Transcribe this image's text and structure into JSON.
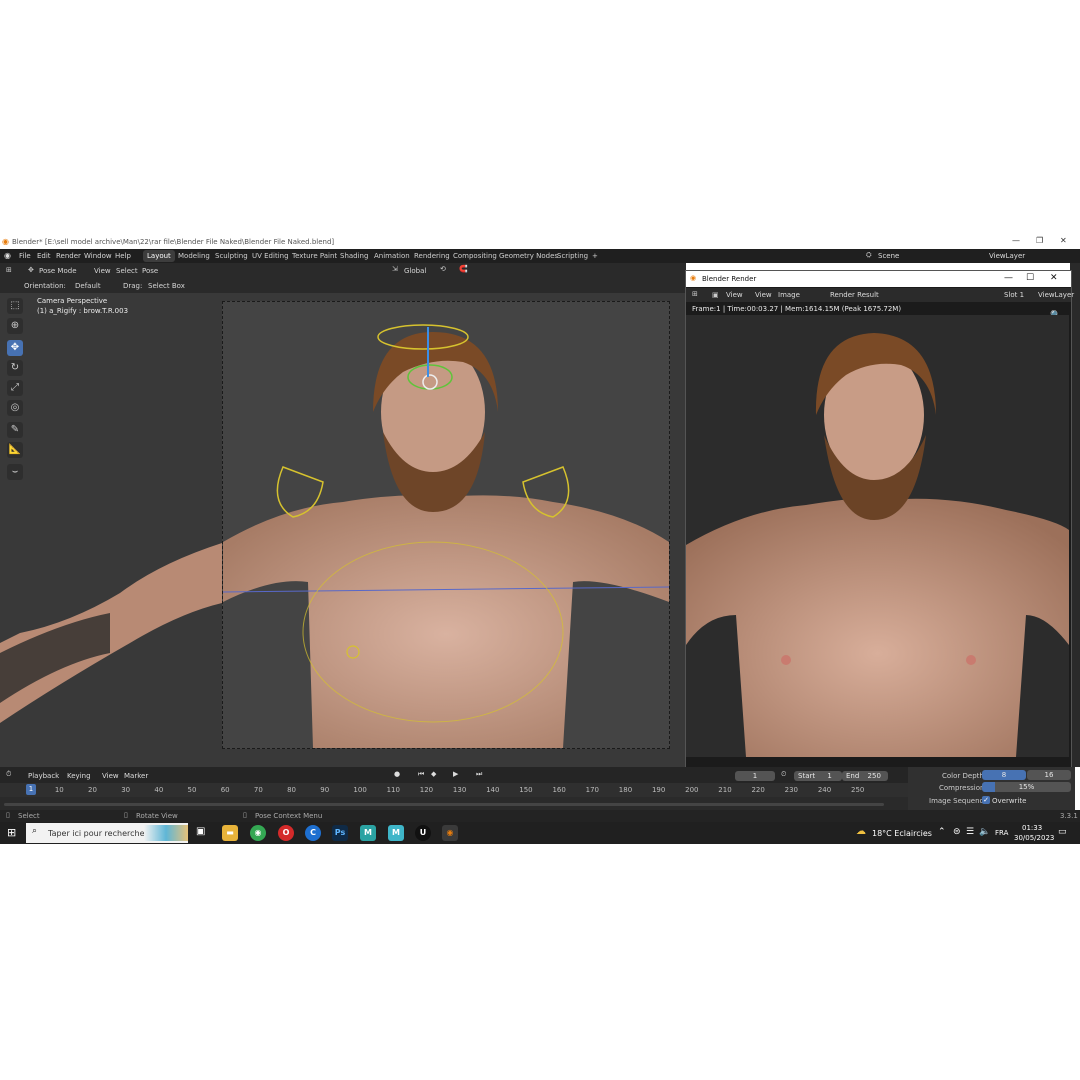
{
  "window": {
    "title": "Blender* [E:\\sell model archive\\Man\\22\\rar file\\Blender File Naked\\Blender File Naked.blend]"
  },
  "menu": [
    "File",
    "Edit",
    "Render",
    "Window",
    "Help"
  ],
  "workspaces": [
    "Layout",
    "Modeling",
    "Sculpting",
    "UV Editing",
    "Texture Paint",
    "Shading",
    "Animation",
    "Rendering",
    "Compositing",
    "Geometry Nodes",
    "Scripting",
    "+"
  ],
  "scene": {
    "label": "Scene",
    "view_layer": "ViewLayer"
  },
  "viewport_header": {
    "mode": "Pose Mode",
    "view": "View",
    "select": "Select",
    "pose": "Pose",
    "transform": "Global",
    "orientation_label": "Orientation:",
    "orientation_value": "Default",
    "drag_label": "Drag:",
    "drag_value": "Select Box"
  },
  "overlay": {
    "camera": "Camera Perspective",
    "active": "(1) a_Rigify : brow.T.R.003"
  },
  "render_window": {
    "title": "Blender Render",
    "menu": [
      "View",
      "View",
      "Image"
    ],
    "image_name": "Render Result",
    "slot": "Slot 1",
    "view_layer": "ViewLayer",
    "stats": "Frame:1 | Time:00:03.27 | Mem:1614.15M (Peak 1675.72M)"
  },
  "timeline": {
    "menu": [
      "Playback",
      "Keying",
      "View",
      "Marker"
    ],
    "current_frame": "1",
    "start_label": "Start",
    "start": "1",
    "end_label": "End",
    "end": "250",
    "ticks": [
      "1",
      "10",
      "20",
      "30",
      "40",
      "50",
      "60",
      "70",
      "80",
      "90",
      "100",
      "110",
      "120",
      "130",
      "140",
      "150",
      "160",
      "170",
      "180",
      "190",
      "200",
      "210",
      "220",
      "230",
      "240",
      "250"
    ]
  },
  "output_props": {
    "color_depth_label": "Color Depth",
    "depth_8": "8",
    "depth_16": "16",
    "compression_label": "Compression",
    "compression": "15%",
    "image_sequence_label": "Image Sequence",
    "overwrite": "Overwrite"
  },
  "statusbar": {
    "select": "Select",
    "rotate": "Rotate View",
    "context": "Pose Context Menu",
    "version": "3.3.1"
  },
  "taskbar": {
    "search_placeholder": "Taper ici pour rechercher",
    "weather": "18°C  Eclaircies",
    "language": "FRA",
    "time": "01:33",
    "date": "30/05/2023"
  },
  "colors": {
    "accent": "#4772b3",
    "viewport": "#393939",
    "header": "#2a2a2a"
  }
}
